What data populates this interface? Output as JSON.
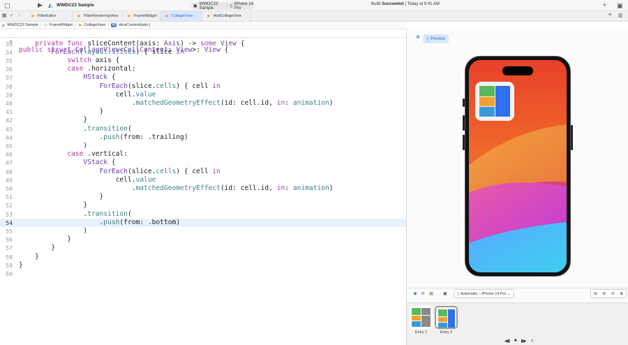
{
  "window": {
    "project": "WWDC23 Sample",
    "scheme": "WWDC23 Sample",
    "device": "iPhone 14 Pro",
    "status_prefix": "Build ",
    "status_bold": "Succeeded",
    "status_suffix": " | Today at 9:41 AM"
  },
  "tabs": [
    {
      "label": "FilterEditor"
    },
    {
      "label": "FilterRenderingView"
    },
    {
      "label": "FrameWidget"
    },
    {
      "label": "CollageView"
    },
    {
      "label": "AddCollageView"
    }
  ],
  "jumpbar": {
    "items": [
      "WWDC23 Sample",
      "FrameWidget",
      "CollageView",
      "sliceContent(axis:)"
    ]
  },
  "editor": {
    "current_line": 54,
    "sticky": {
      "n": "8",
      "code": "public struct CollageView<CellContent: View>: View {"
    },
    "lines": [
      {
        "n": "33",
        "code": "    private func sliceContent(axis: Axis) -> some View {"
      },
      {
        "n": "34",
        "code": "        ForEach(layout.slices) { slice in"
      },
      {
        "n": "35",
        "code": "            switch axis {"
      },
      {
        "n": "36",
        "code": "            case .horizontal:"
      },
      {
        "n": "37",
        "code": "                HStack {"
      },
      {
        "n": "38",
        "code": "                    ForEach(slice.cells) { cell in"
      },
      {
        "n": "39",
        "code": "                        cell.value"
      },
      {
        "n": "40",
        "code": "                            .matchedGeometryEffect(id: cell.id, in: animation)"
      },
      {
        "n": "41",
        "code": "                    }"
      },
      {
        "n": "42",
        "code": "                }"
      },
      {
        "n": "43",
        "code": "                .transition("
      },
      {
        "n": "44",
        "code": "                    .push(from: .trailing)"
      },
      {
        "n": "45",
        "code": "                )"
      },
      {
        "n": "46",
        "code": "            case .vertical:"
      },
      {
        "n": "47",
        "code": "                VStack {"
      },
      {
        "n": "48",
        "code": "                    ForEach(slice.cells) { cell in"
      },
      {
        "n": "49",
        "code": "                        cell.value"
      },
      {
        "n": "50",
        "code": "                            .matchedGeometryEffect(id: cell.id, in: animation)"
      },
      {
        "n": "51",
        "code": "                    }"
      },
      {
        "n": "52",
        "code": "                }"
      },
      {
        "n": "53",
        "code": "                .transition("
      },
      {
        "n": "54",
        "code": "                    .push(from: .bottom)"
      },
      {
        "n": "55",
        "code": "                )"
      },
      {
        "n": "56",
        "code": "            }"
      },
      {
        "n": "57",
        "code": "        }"
      },
      {
        "n": "58",
        "code": "    }"
      },
      {
        "n": "59",
        "code": "}"
      },
      {
        "n": "60",
        "code": ""
      }
    ]
  },
  "preview": {
    "mode_label": "Preview",
    "device_selector": "Automatic – iPhone 14 Pro",
    "entries": [
      {
        "label": "Entry 1"
      },
      {
        "label": "Entry 2"
      }
    ]
  },
  "colors": {
    "accent": "#2a6fd6",
    "cell_green": "#5cb85c",
    "cell_orange": "#f0a030",
    "cell_blue": "#3a9ad9",
    "cell_blue_tall": "#2f6ff0",
    "cell_gray": "#8a8a8a"
  }
}
